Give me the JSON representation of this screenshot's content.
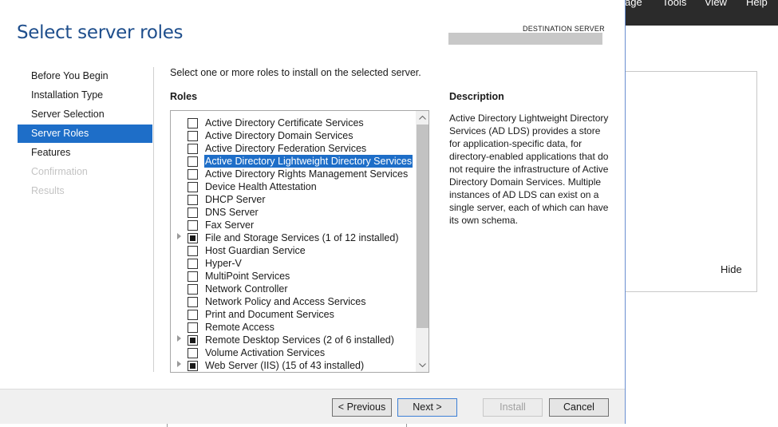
{
  "background": {
    "menu": [
      "age",
      "Tools",
      "View",
      "Help"
    ],
    "hide_label": "Hide"
  },
  "wizard": {
    "title": "Select server roles",
    "destination_label": "DESTINATION SERVER",
    "nav": [
      {
        "label": "Before You Begin",
        "state": "normal"
      },
      {
        "label": "Installation Type",
        "state": "normal"
      },
      {
        "label": "Server Selection",
        "state": "normal"
      },
      {
        "label": "Server Roles",
        "state": "active"
      },
      {
        "label": "Features",
        "state": "normal"
      },
      {
        "label": "Confirmation",
        "state": "disabled"
      },
      {
        "label": "Results",
        "state": "disabled"
      }
    ],
    "instruction": "Select one or more roles to install on the selected server.",
    "roles_heading": "Roles",
    "roles": [
      {
        "label": "Active Directory Certificate Services",
        "expandable": false,
        "checked": "none",
        "selected": false
      },
      {
        "label": "Active Directory Domain Services",
        "expandable": false,
        "checked": "none",
        "selected": false
      },
      {
        "label": "Active Directory Federation Services",
        "expandable": false,
        "checked": "none",
        "selected": false
      },
      {
        "label": "Active Directory Lightweight Directory Services",
        "expandable": false,
        "checked": "none",
        "selected": true
      },
      {
        "label": "Active Directory Rights Management Services",
        "expandable": false,
        "checked": "none",
        "selected": false
      },
      {
        "label": "Device Health Attestation",
        "expandable": false,
        "checked": "none",
        "selected": false
      },
      {
        "label": "DHCP Server",
        "expandable": false,
        "checked": "none",
        "selected": false
      },
      {
        "label": "DNS Server",
        "expandable": false,
        "checked": "none",
        "selected": false
      },
      {
        "label": "Fax Server",
        "expandable": false,
        "checked": "none",
        "selected": false
      },
      {
        "label": "File and Storage Services (1 of 12 installed)",
        "expandable": true,
        "checked": "partial",
        "selected": false
      },
      {
        "label": "Host Guardian Service",
        "expandable": false,
        "checked": "none",
        "selected": false
      },
      {
        "label": "Hyper-V",
        "expandable": false,
        "checked": "none",
        "selected": false
      },
      {
        "label": "MultiPoint Services",
        "expandable": false,
        "checked": "none",
        "selected": false
      },
      {
        "label": "Network Controller",
        "expandable": false,
        "checked": "none",
        "selected": false
      },
      {
        "label": "Network Policy and Access Services",
        "expandable": false,
        "checked": "none",
        "selected": false
      },
      {
        "label": "Print and Document Services",
        "expandable": false,
        "checked": "none",
        "selected": false
      },
      {
        "label": "Remote Access",
        "expandable": false,
        "checked": "none",
        "selected": false
      },
      {
        "label": "Remote Desktop Services (2 of 6 installed)",
        "expandable": true,
        "checked": "partial",
        "selected": false
      },
      {
        "label": "Volume Activation Services",
        "expandable": false,
        "checked": "none",
        "selected": false
      },
      {
        "label": "Web Server (IIS) (15 of 43 installed)",
        "expandable": true,
        "checked": "partial",
        "selected": false
      }
    ],
    "description_heading": "Description",
    "description": "Active Directory Lightweight Directory Services (AD LDS) provides a store for application-specific data, for directory-enabled applications that do not require the infrastructure of Active Directory Domain Services. Multiple instances of AD LDS can exist on a single server, each of which can have its own schema.",
    "buttons": {
      "previous": "< Previous",
      "next": "Next >",
      "install": "Install",
      "cancel": "Cancel"
    }
  },
  "colors": {
    "accent": "#1e6ec8",
    "title": "#1e4e8c",
    "menubar": "#2b2b2b"
  }
}
